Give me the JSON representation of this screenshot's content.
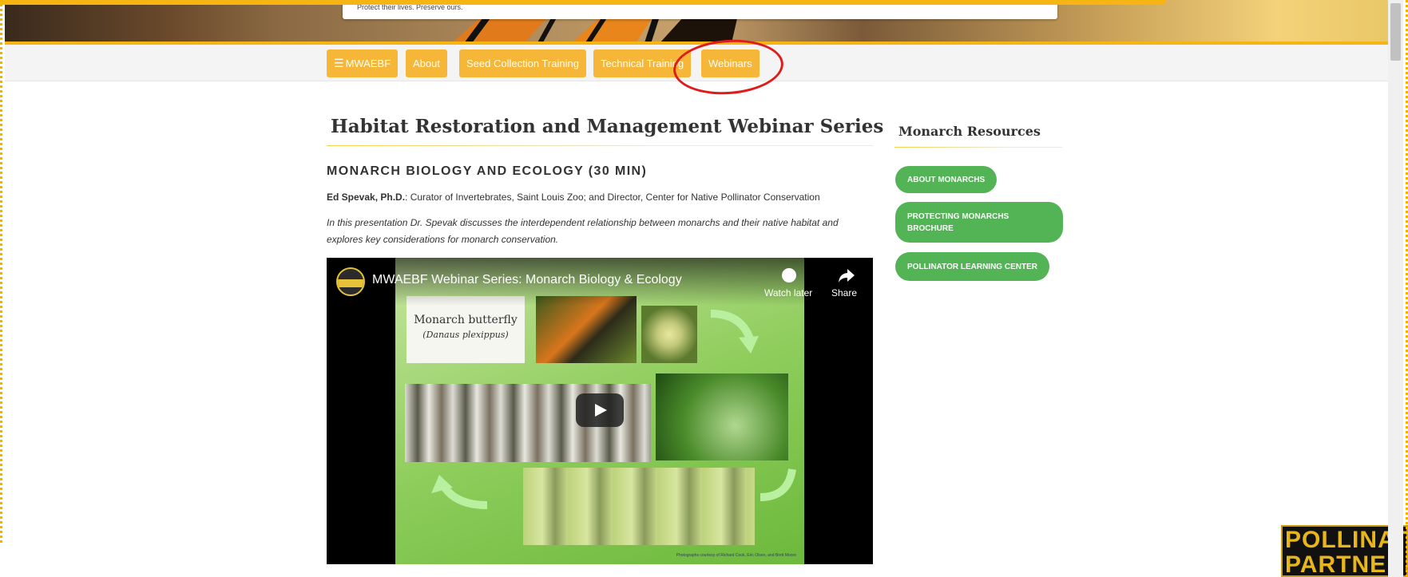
{
  "hero": {
    "tagline": "Protect their lives. Preserve ours."
  },
  "nav": {
    "items": [
      {
        "label": "MWAEBF",
        "icon": "hamburger-menu-icon"
      },
      {
        "label": "About"
      },
      {
        "label": "Seed Collection Training"
      },
      {
        "label": "Technical Training"
      },
      {
        "label": "Webinars"
      }
    ],
    "highlight_color": "#e01b1b"
  },
  "main": {
    "page_title": "Habitat Restoration and Management Webinar Series",
    "section_heading": "MONARCH BIOLOGY AND ECOLOGY (30 MIN)",
    "speaker_name": "Ed Spevak, Ph.D.",
    "speaker_role": ": Curator of Invertebrates, Saint Louis Zoo; and Director, Center for Native Pollinator Conservation",
    "description": "In this presentation Dr. Spevak discusses the interdependent relationship between monarchs and their native habitat and explores key considerations for monarch conservation."
  },
  "video": {
    "title": "MWAEBF Webinar Series: Monarch Biology & Ecology",
    "watch_later": "Watch later",
    "share": "Share",
    "slide_title": "Monarch butterfly",
    "slide_subtitle": "(Danaus plexippus)",
    "slide_credit": "Photographs courtesy of Richard Cook, Eric Olsen, and Brett Moore"
  },
  "sidebar": {
    "title": "Monarch Resources",
    "buttons": [
      "ABOUT MONARCHS",
      "PROTECTING MONARCHS BROCHURE",
      "POLLINATOR LEARNING CENTER"
    ]
  },
  "logo": {
    "line1": "POLLINATOR",
    "line2": "PARTNERSHIP"
  },
  "colors": {
    "nav_button": "#f6b637",
    "accent_yellow": "#f6b513",
    "resource_green": "#52b454"
  }
}
